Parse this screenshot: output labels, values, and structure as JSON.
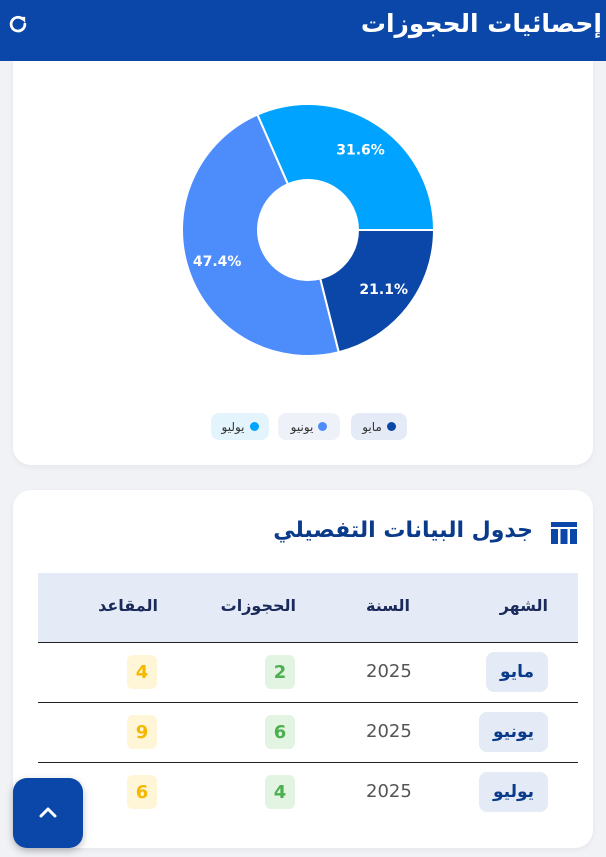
{
  "header": {
    "title": "إحصائيات الحجوزات",
    "refresh_icon": "refresh-icon"
  },
  "chart_data": {
    "type": "pie",
    "categories": [
      "مايو",
      "يونيو",
      "يوليو"
    ],
    "values": [
      21.1,
      47.4,
      31.6
    ],
    "labels": [
      "21.1%",
      "47.4%",
      "31.6%"
    ],
    "colors": [
      "#0a47a8",
      "#4d8dfb",
      "#00a3ff"
    ],
    "legend": "bottom"
  },
  "legend": [
    {
      "label": "مايو",
      "color": "#0a47a8",
      "bg": "#e4ebf6"
    },
    {
      "label": "يونيو",
      "color": "#4d8dfb",
      "bg": "#eef1f7"
    },
    {
      "label": "يوليو",
      "color": "#00a3ff",
      "bg": "#e4f4fd"
    }
  ],
  "table": {
    "title": "جدول البيانات التفصيلي",
    "icon": "table-icon",
    "headers": {
      "month": "الشهر",
      "year": "السنة",
      "bookings": "الحجوزات",
      "seats": "المقاعد"
    },
    "rows": [
      {
        "month": "مايو",
        "year": "2025",
        "bookings": "2",
        "seats": "4"
      },
      {
        "month": "يونيو",
        "year": "2025",
        "bookings": "6",
        "seats": "9"
      },
      {
        "month": "يوليو",
        "year": "2025",
        "bookings": "4",
        "seats": "6"
      }
    ]
  },
  "scroll_top": {
    "icon": "chevron-up-icon"
  }
}
